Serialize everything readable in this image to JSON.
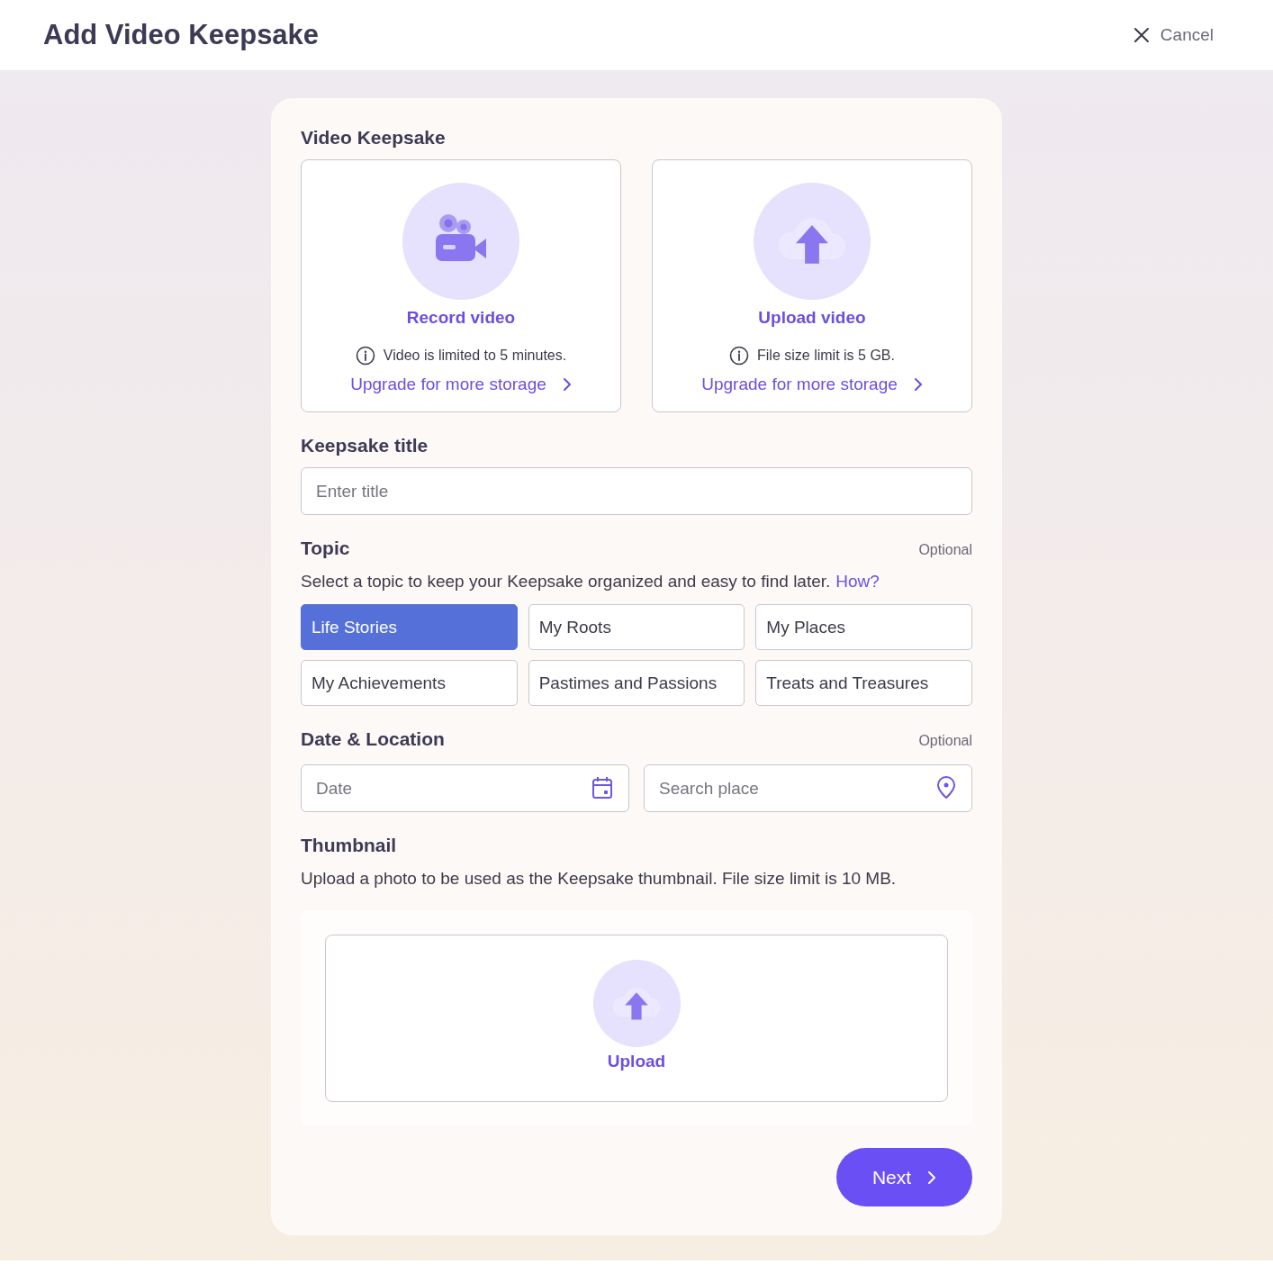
{
  "header": {
    "title": "Add Video Keepsake",
    "cancel": "Cancel"
  },
  "video": {
    "label": "Video Keepsake",
    "options": [
      {
        "kind": "record",
        "title": "Record video",
        "info": "Video is limited to 5 minutes.",
        "link": "Upgrade for more storage"
      },
      {
        "kind": "upload",
        "title": "Upload video",
        "info": "File size limit is 5 GB.",
        "link": "Upgrade for more storage"
      }
    ]
  },
  "keepsake_title": {
    "label": "Keepsake title",
    "placeholder": "Enter title"
  },
  "topic": {
    "label": "Topic",
    "optional": "Optional",
    "description": "Select a topic to keep your Keepsake organized and easy to find later.",
    "help_link": "How?",
    "topics": [
      {
        "label": "Life Stories",
        "selected": true
      },
      {
        "label": "My Roots",
        "selected": false
      },
      {
        "label": "My Places",
        "selected": false
      },
      {
        "label": "My Achievements",
        "selected": false
      },
      {
        "label": "Pastimes and Passions",
        "selected": false
      },
      {
        "label": "Treats and Treasures",
        "selected": false
      }
    ]
  },
  "date_location": {
    "label": "Date & Location",
    "optional": "Optional",
    "date_placeholder": "Date",
    "place_placeholder": "Search place"
  },
  "thumbnail": {
    "label": "Thumbnail",
    "description": "Upload a photo to be used as the Keepsake thumbnail. File size limit is 10 MB.",
    "upload": "Upload"
  },
  "next": "Next"
}
